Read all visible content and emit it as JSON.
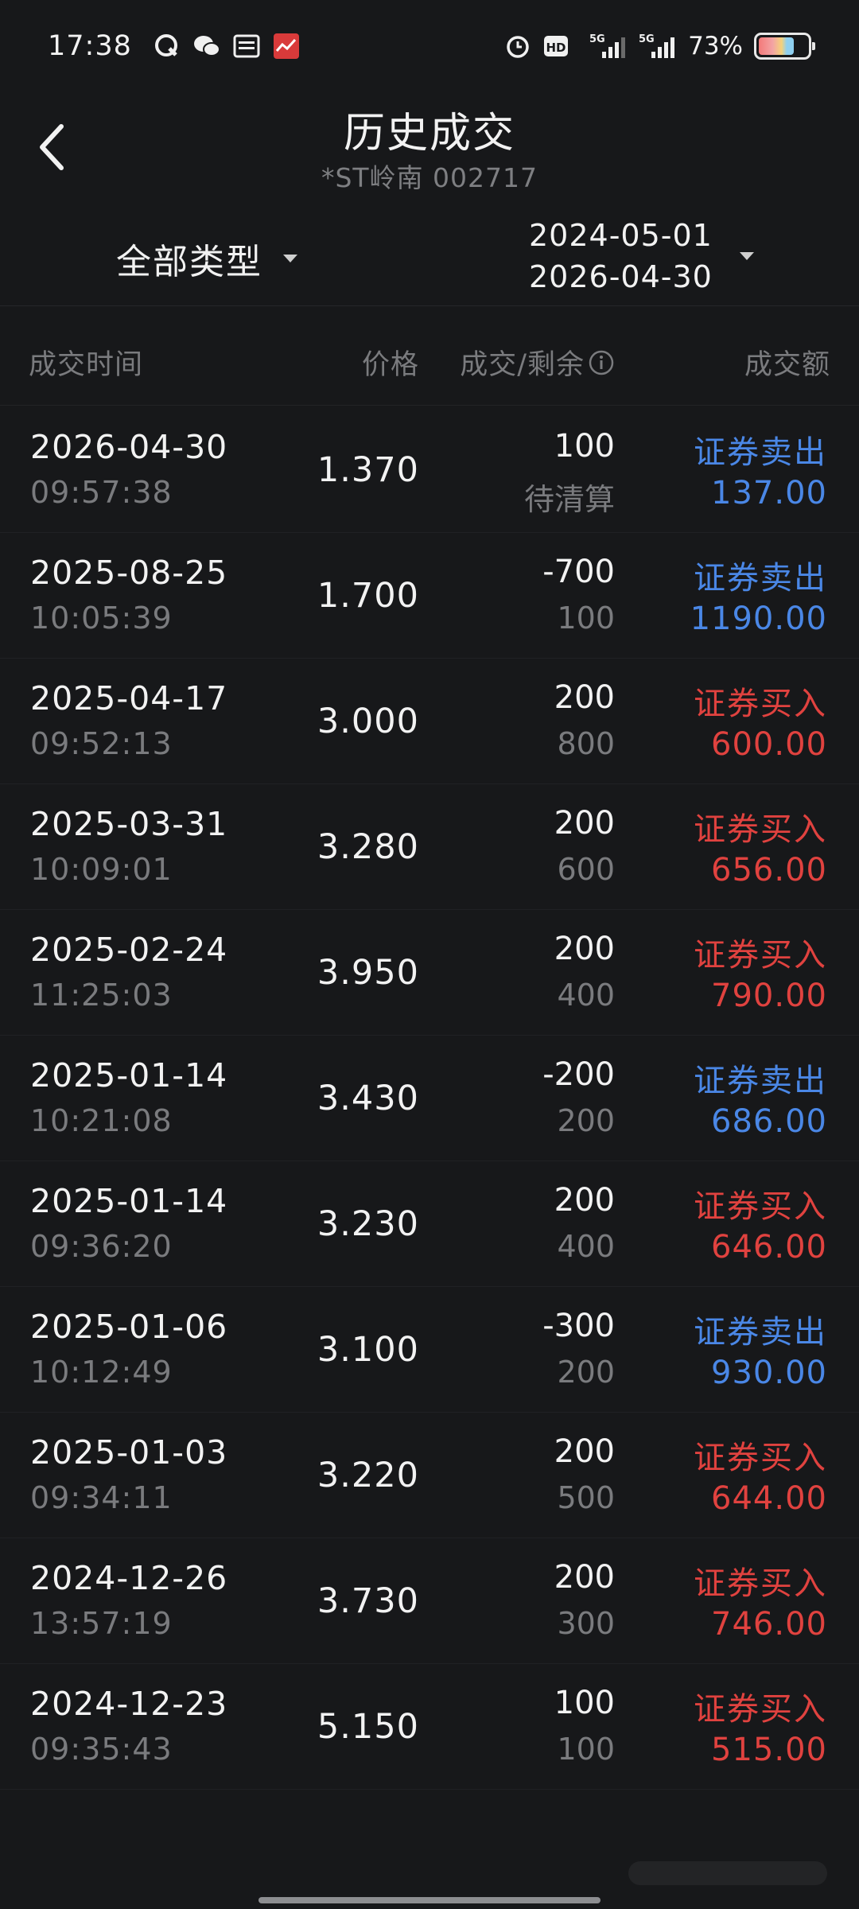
{
  "status_bar": {
    "time": "17:38",
    "battery_text": "73%",
    "battery_level": 0.73,
    "signal_labels": [
      "HD",
      "5G",
      "5G"
    ]
  },
  "header": {
    "title": "历史成交",
    "subtitle": "*ST岭南 002717"
  },
  "filters": {
    "type_label": "全部类型",
    "date_start": "2024-05-01",
    "date_end": "2026-04-30"
  },
  "columns": {
    "time": "成交时间",
    "price": "价格",
    "qty": "成交/剩余",
    "amount": "成交额"
  },
  "colors": {
    "sell": "#4a87e6",
    "buy": "#e0423f",
    "background": "#17181a"
  },
  "trades": [
    {
      "date": "2026-04-30",
      "time": "09:57:38",
      "price": "1.370",
      "qty": "100",
      "remain": "待清算",
      "type": "证券卖出",
      "amount": "137.00",
      "side": "sell"
    },
    {
      "date": "2025-08-25",
      "time": "10:05:39",
      "price": "1.700",
      "qty": "-700",
      "remain": "100",
      "type": "证券卖出",
      "amount": "1190.00",
      "side": "sell"
    },
    {
      "date": "2025-04-17",
      "time": "09:52:13",
      "price": "3.000",
      "qty": "200",
      "remain": "800",
      "type": "证券买入",
      "amount": "600.00",
      "side": "buy"
    },
    {
      "date": "2025-03-31",
      "time": "10:09:01",
      "price": "3.280",
      "qty": "200",
      "remain": "600",
      "type": "证券买入",
      "amount": "656.00",
      "side": "buy"
    },
    {
      "date": "2025-02-24",
      "time": "11:25:03",
      "price": "3.950",
      "qty": "200",
      "remain": "400",
      "type": "证券买入",
      "amount": "790.00",
      "side": "buy"
    },
    {
      "date": "2025-01-14",
      "time": "10:21:08",
      "price": "3.430",
      "qty": "-200",
      "remain": "200",
      "type": "证券卖出",
      "amount": "686.00",
      "side": "sell"
    },
    {
      "date": "2025-01-14",
      "time": "09:36:20",
      "price": "3.230",
      "qty": "200",
      "remain": "400",
      "type": "证券买入",
      "amount": "646.00",
      "side": "buy"
    },
    {
      "date": "2025-01-06",
      "time": "10:12:49",
      "price": "3.100",
      "qty": "-300",
      "remain": "200",
      "type": "证券卖出",
      "amount": "930.00",
      "side": "sell"
    },
    {
      "date": "2025-01-03",
      "time": "09:34:11",
      "price": "3.220",
      "qty": "200",
      "remain": "500",
      "type": "证券买入",
      "amount": "644.00",
      "side": "buy"
    },
    {
      "date": "2024-12-26",
      "time": "13:57:19",
      "price": "3.730",
      "qty": "200",
      "remain": "300",
      "type": "证券买入",
      "amount": "746.00",
      "side": "buy"
    },
    {
      "date": "2024-12-23",
      "time": "09:35:43",
      "price": "5.150",
      "qty": "100",
      "remain": "100",
      "type": "证券买入",
      "amount": "515.00",
      "side": "buy"
    }
  ]
}
